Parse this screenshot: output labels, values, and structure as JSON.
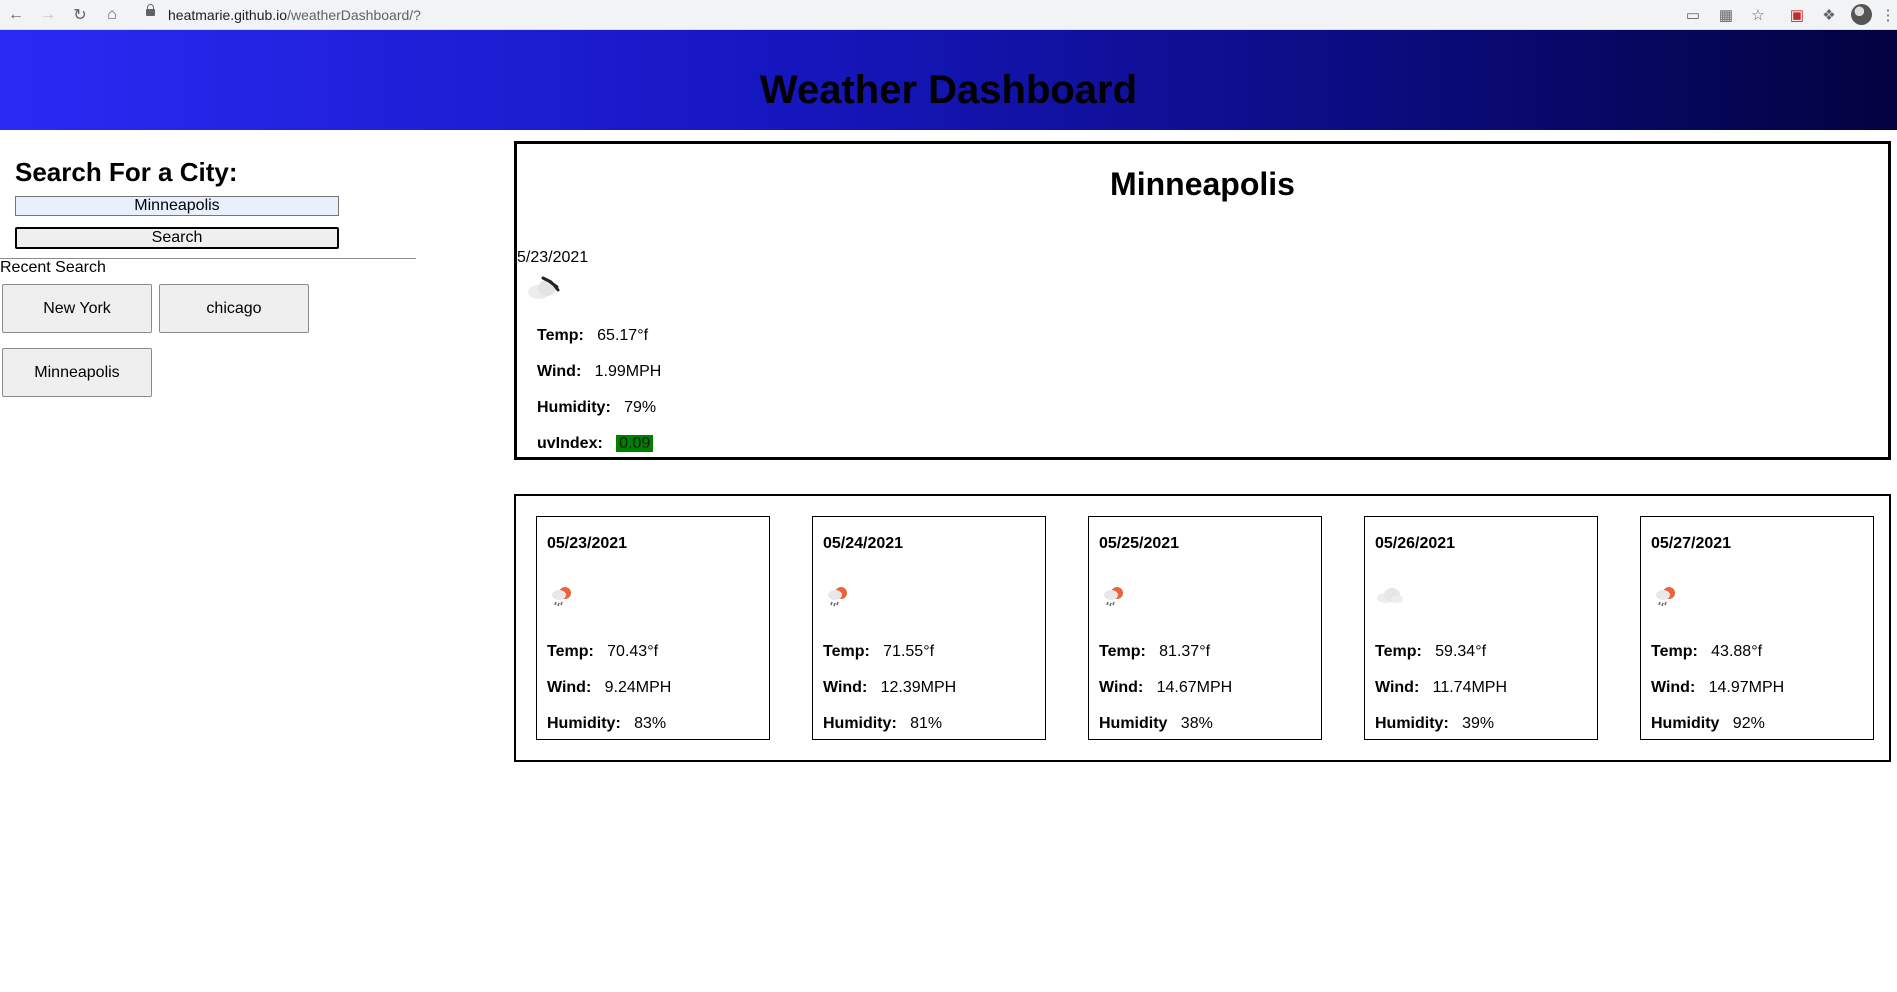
{
  "browser": {
    "url_host": "heatmarie.github.io",
    "url_path": "/weatherDashboard/?"
  },
  "header": {
    "title": "Weather Dashboard"
  },
  "sidebar": {
    "title": "Search For a City:",
    "search_value": "Minneapolis",
    "search_button": "Search",
    "recent_label": "Recent Search",
    "recent": [
      "New York",
      "chicago",
      "Minneapolis"
    ]
  },
  "current": {
    "city": "Minneapolis",
    "date": "5/23/2021",
    "icon": "cloud-icon",
    "temp_label": "Temp:",
    "temp": "65.17°f",
    "wind_label": "Wind:",
    "wind": "1.99MPH",
    "humidity_label": "Humidity:",
    "humidity": "79%",
    "uv_label": "uvIndex:",
    "uv": "0.09",
    "uv_color": "#008000"
  },
  "forecast": [
    {
      "date": "05/23/2021",
      "icon": "rain-sun-icon",
      "temp_label": "Temp:",
      "temp": "70.43°f",
      "wind_label": "Wind:",
      "wind": "9.24MPH",
      "humidity_label": "Humidity:",
      "humidity": "83%"
    },
    {
      "date": "05/24/2021",
      "icon": "rain-sun-icon",
      "temp_label": "Temp:",
      "temp": "71.55°f",
      "wind_label": "Wind:",
      "wind": "12.39MPH",
      "humidity_label": "Humidity:",
      "humidity": "81%"
    },
    {
      "date": "05/25/2021",
      "icon": "rain-sun-icon",
      "temp_label": "Temp:",
      "temp": "81.37°f",
      "wind_label": "Wind:",
      "wind": "14.67MPH",
      "humidity_label": "Humidity",
      "humidity": "38%"
    },
    {
      "date": "05/26/2021",
      "icon": "cloud-icon",
      "temp_label": "Temp:",
      "temp": "59.34°f",
      "wind_label": "Wind:",
      "wind": "11.74MPH",
      "humidity_label": "Humidity:",
      "humidity": "39%"
    },
    {
      "date": "05/27/2021",
      "icon": "rain-sun-icon",
      "temp_label": "Temp:",
      "temp": "43.88°f",
      "wind_label": "Wind:",
      "wind": "14.97MPH",
      "humidity_label": "Humidity",
      "humidity": "92%"
    }
  ]
}
